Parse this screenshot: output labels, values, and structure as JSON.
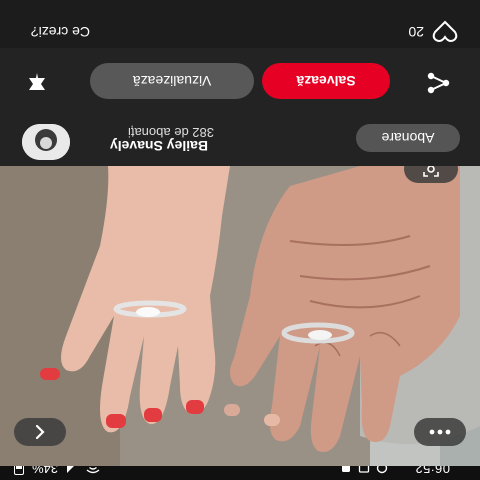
{
  "status_bar": {
    "time": "06:52",
    "right_text": "34%"
  },
  "photo": {
    "alt": ""
  },
  "creator": {
    "name": "Bailey Snavely",
    "followers": "382 de abonați",
    "follow_label": "Abonare"
  },
  "actions": {
    "save_label": "Salvează",
    "visit_label": "Vizualizează"
  },
  "reactions": {
    "count": "20",
    "prompt": "Ce crezi?"
  },
  "colors": {
    "save": "#e60023",
    "visit": "#585858",
    "follow": "#555555",
    "background": "#1c1c1c"
  },
  "icons": {
    "more": "more-icon",
    "back": "chevron-left-icon",
    "lens": "visual-search-icon",
    "share": "share-icon",
    "pin": "pin-icon",
    "heart": "heart-icon"
  }
}
